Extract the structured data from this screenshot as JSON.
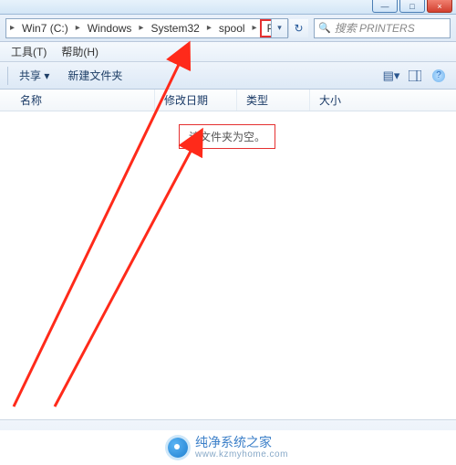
{
  "titlebar": {
    "minimize": "—",
    "maximize": "□",
    "close": "×"
  },
  "breadcrumb": {
    "items": [
      {
        "label": "Win7 (C:)"
      },
      {
        "label": "Windows"
      },
      {
        "label": "System32"
      },
      {
        "label": "spool"
      },
      {
        "label": "PRINTERS"
      }
    ],
    "arrow": "▸",
    "drop": "▾",
    "refresh": "↻"
  },
  "search": {
    "icon": "🔍",
    "placeholder": "搜索 PRINTERS"
  },
  "menu": {
    "tools": "工具(T)",
    "help": "帮助(H)"
  },
  "toolbar": {
    "share": "共享 ▾",
    "newfolder": "新建文件夹",
    "view_icon": "▤",
    "help_icon": "?"
  },
  "columns": {
    "name": "名称",
    "date": "修改日期",
    "type": "类型",
    "size": "大小"
  },
  "empty_text": "该文件夹为空。",
  "watermark": {
    "cn": "纯净系统之家",
    "url": "www.kzmyhome.com"
  }
}
